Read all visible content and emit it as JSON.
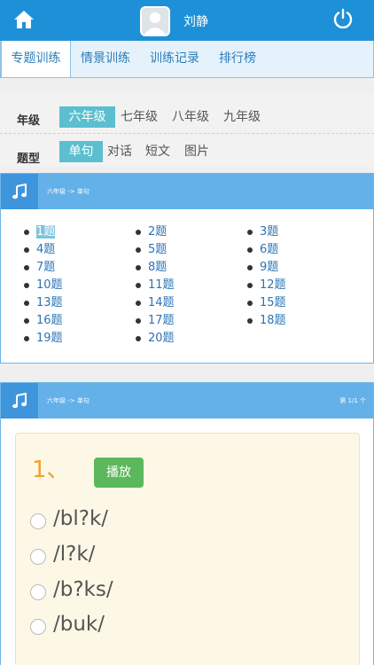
{
  "header": {
    "username": "刘静",
    "home_icon": "home-icon",
    "power_icon": "power-icon",
    "avatar_icon": "user-avatar"
  },
  "tabs": [
    {
      "label": "专题训练",
      "active": true
    },
    {
      "label": "情景训练",
      "active": false
    },
    {
      "label": "训练记录",
      "active": false
    },
    {
      "label": "排行榜",
      "active": false
    }
  ],
  "filters": {
    "grade_label": "年级",
    "grades": [
      "六年级",
      "七年级",
      "八年级",
      "九年级"
    ],
    "grade_selected": "六年级",
    "type_label": "题型",
    "types": [
      "单句",
      "对话",
      "短文",
      "图片"
    ],
    "type_selected": "单句"
  },
  "list_panel": {
    "breadcrumb": "六年级 -> 单句",
    "questions": [
      "1题",
      "2题",
      "3题",
      "4题",
      "5题",
      "6题",
      "7题",
      "8题",
      "9题",
      "10题",
      "11题",
      "12题",
      "13题",
      "14题",
      "15题",
      "16题",
      "17题",
      "18题",
      "19题",
      "20题"
    ],
    "selected": "1题"
  },
  "question_panel": {
    "breadcrumb": "六年级 -> 单句",
    "page_info": "第 1/1 个",
    "question_number": "1、",
    "play_label": "播放",
    "choices": [
      "/bl?k/",
      "/l?k/",
      "/b?ks/",
      "/buk/"
    ]
  },
  "colors": {
    "header_blue": "#1e90d8",
    "selected_tab_bg": "#5bbfd0",
    "play_green": "#5cb85c",
    "question_orange": "#f0a030"
  }
}
